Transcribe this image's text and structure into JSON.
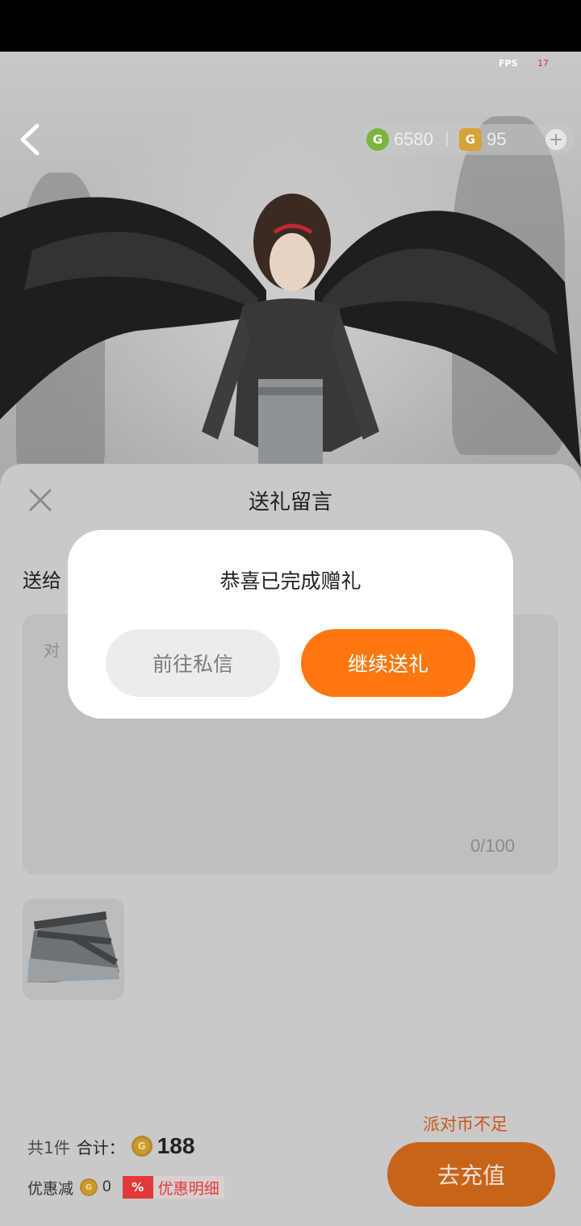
{
  "hud": {
    "fps_label": "FPS",
    "fps_value": "17",
    "green_coins": "6580",
    "gold_coins": "95",
    "green_coin_glyph": "G",
    "gold_coin_glyph": "G",
    "add_glyph": "+"
  },
  "sheet": {
    "title": "送礼留言",
    "send_to_label": "送给",
    "message_placeholder": "对",
    "char_counter": "0/100"
  },
  "summary": {
    "item_count": "共1件",
    "total_label": "合计：",
    "total_amount": "188",
    "discount_label": "优惠减",
    "discount_amount": "0",
    "discount_badge": "%",
    "discount_detail_label": "优惠明细",
    "insufficient_text": "派对币不足",
    "recharge_button": "去充值"
  },
  "dialog": {
    "message": "恭喜已完成赠礼",
    "goto_dm_button": "前往私信",
    "continue_button": "继续送礼"
  },
  "colors": {
    "accent_orange": "#ff7710",
    "green_coin": "#79b53f",
    "gold_coin": "#d6a23a",
    "discount_red": "#e23a3a"
  }
}
